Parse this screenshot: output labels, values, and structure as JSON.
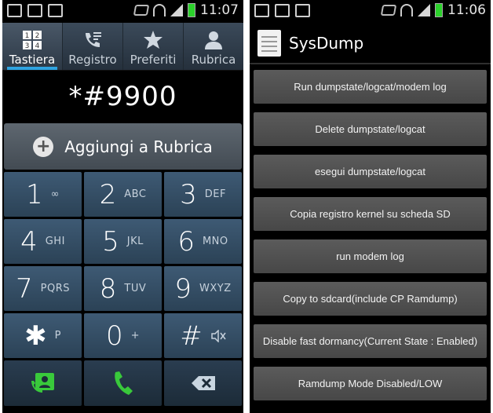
{
  "status": {
    "left_time": "11:07",
    "right_time": "11:06"
  },
  "dialer": {
    "tabs": [
      {
        "label": "Tastiera",
        "icon": "keypad-icon"
      },
      {
        "label": "Registro",
        "icon": "call-log-icon"
      },
      {
        "label": "Preferiti",
        "icon": "star-icon"
      },
      {
        "label": "Rubrica",
        "icon": "contact-icon"
      }
    ],
    "number": "*#9900",
    "add_contact": "Aggiungi a Rubrica",
    "keys": [
      {
        "num": "1",
        "sub": "∞"
      },
      {
        "num": "2",
        "sub": "ABC"
      },
      {
        "num": "3",
        "sub": "DEF"
      },
      {
        "num": "4",
        "sub": "GHI"
      },
      {
        "num": "5",
        "sub": "JKL"
      },
      {
        "num": "6",
        "sub": "MNO"
      },
      {
        "num": "7",
        "sub": "PQRS"
      },
      {
        "num": "8",
        "sub": "TUV"
      },
      {
        "num": "9",
        "sub": "WXYZ"
      },
      {
        "num": "✱",
        "sub": "P"
      },
      {
        "num": "0",
        "sub": "+"
      },
      {
        "num": "#",
        "sub": ""
      }
    ]
  },
  "sysdump": {
    "title": "SysDump",
    "buttons": [
      "Run dumpstate/logcat/modem log",
      "Delete dumpstate/logcat",
      "esegui dumpstate/logcat",
      "Copia registro kernel su scheda SD",
      "run modem log",
      "Copy to sdcard(include CP Ramdump)",
      "Disable fast dormancy(Current State : Enabled)",
      "Ramdump Mode Disabled/LOW"
    ]
  },
  "colors": {
    "accent": "#2fa3e0",
    "call_green": "#39c93b",
    "battery": "#2bd12b"
  }
}
